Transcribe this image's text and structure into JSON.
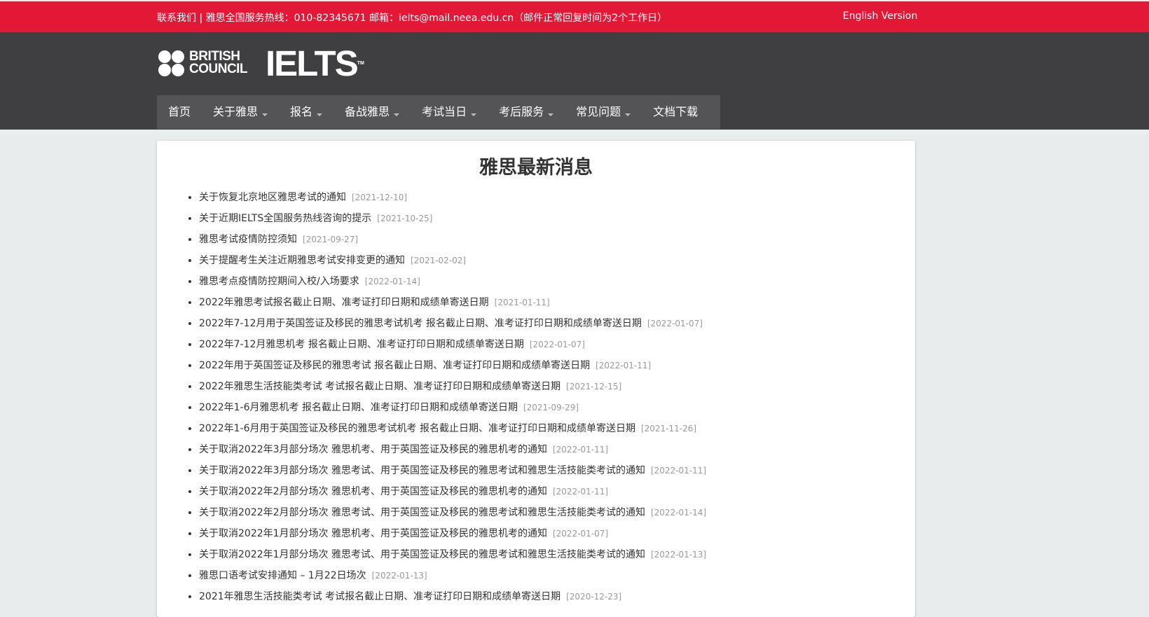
{
  "topbar": {
    "contact": "联系我们 | 雅思全国服务热线：010-82345671    邮箱：ielts@mail.neea.edu.cn（邮件正常回复时间为2个工作日）",
    "english_version": "English Version"
  },
  "logo": {
    "british": "BRITISH",
    "council": "COUNCIL",
    "ielts": "IELTS",
    "tm": "TM"
  },
  "nav": [
    {
      "label": "首页"
    },
    {
      "label": "关于雅思"
    },
    {
      "label": "报名"
    },
    {
      "label": "备战雅思"
    },
    {
      "label": "考试当日"
    },
    {
      "label": "考后服务"
    },
    {
      "label": "常见问题"
    },
    {
      "label": "文档下载"
    }
  ],
  "main": {
    "title": "雅思最新消息",
    "news": [
      {
        "title": "关于恢复北京地区雅思考试的通知",
        "date": "[2021-12-10]"
      },
      {
        "title": "关于近期IELTS全国服务热线咨询的提示",
        "date": "[2021-10-25]"
      },
      {
        "title": "雅思考试疫情防控须知",
        "date": "[2021-09-27]"
      },
      {
        "title": "关于提醒考生关注近期雅思考试安排变更的通知",
        "date": "[2021-02-02]"
      },
      {
        "title": "雅思考点疫情防控期间入校/入场要求",
        "date": "[2022-01-14]"
      },
      {
        "title": "2022年雅思考试报名截止日期、准考证打印日期和成绩单寄送日期",
        "date": "[2021-01-11]"
      },
      {
        "title": "2022年7-12月用于英国签证及移民的雅思考试机考 报名截止日期、准考证打印日期和成绩单寄送日期",
        "date": "[2022-01-07]"
      },
      {
        "title": "2022年7-12月雅思机考 报名截止日期、准考证打印日期和成绩单寄送日期",
        "date": "[2022-01-07]"
      },
      {
        "title": "2022年用于英国签证及移民的雅思考试 报名截止日期、准考证打印日期和成绩单寄送日期",
        "date": "[2022-01-11]"
      },
      {
        "title": "2022年雅思生活技能类考试 考试报名截止日期、准考证打印日期和成绩单寄送日期",
        "date": "[2021-12-15]"
      },
      {
        "title": "2022年1-6月雅思机考 报名截止日期、准考证打印日期和成绩单寄送日期",
        "date": "[2021-09-29]"
      },
      {
        "title": "2022年1-6月用于英国签证及移民的雅思考试机考 报名截止日期、准考证打印日期和成绩单寄送日期",
        "date": "[2021-11-26]"
      },
      {
        "title": "关于取消2022年3月部分场次 雅思机考、用于英国签证及移民的雅思机考的通知",
        "date": "[2022-01-11]"
      },
      {
        "title": "关于取消2022年3月部分场次 雅思考试、用于英国签证及移民的雅思考试和雅思生活技能类考试的通知",
        "date": "[2022-01-11]"
      },
      {
        "title": "关于取消2022年2月部分场次 雅思机考、用于英国签证及移民的雅思机考的通知",
        "date": "[2022-01-11]"
      },
      {
        "title": "关于取消2022年2月部分场次 雅思考试、用于英国签证及移民的雅思考试和雅思生活技能类考试的通知",
        "date": "[2022-01-14]"
      },
      {
        "title": "关于取消2022年1月部分场次 雅思机考、用于英国签证及移民的雅思机考的通知",
        "date": "[2022-01-07]"
      },
      {
        "title": "关于取消2022年1月部分场次 雅思考试、用于英国签证及移民的雅思考试和雅思生活技能类考试的通知",
        "date": "[2022-01-13]"
      },
      {
        "title": "雅思口语考试安排通知 – 1月22日场次",
        "date": "[2022-01-13]"
      },
      {
        "title": "2021年雅思生活技能类考试 考试报名截止日期、准考证打印日期和成绩单寄送日期",
        "date": "[2020-12-23]"
      }
    ]
  }
}
